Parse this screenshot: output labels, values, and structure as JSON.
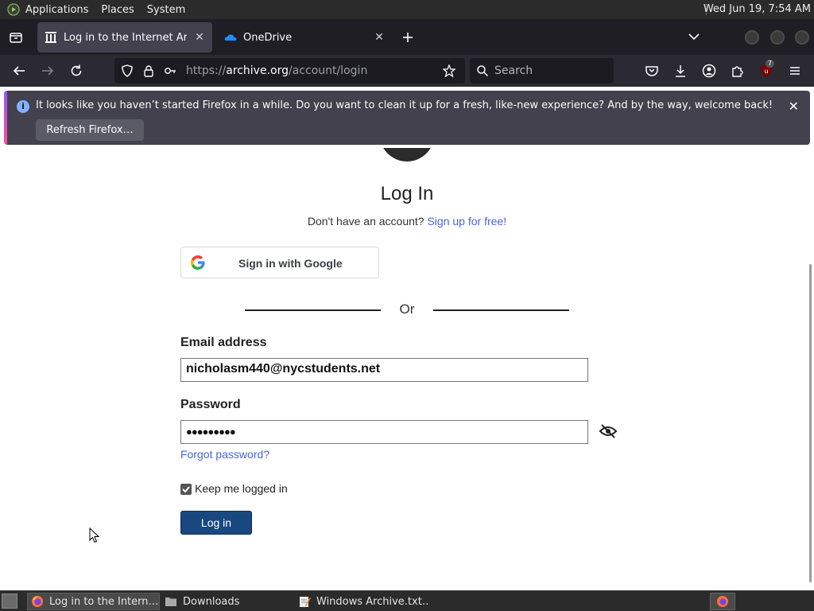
{
  "panel": {
    "menus": [
      "Applications",
      "Places",
      "System"
    ],
    "clock": "Wed Jun 19,  7:54 AM"
  },
  "tabs": [
    {
      "title": "Log in to the Internet Archive",
      "favicon": "archive-icon",
      "active": true
    },
    {
      "title": "OneDrive",
      "favicon": "onedrive-icon",
      "active": false
    }
  ],
  "navbar": {
    "url_prefix": "https://",
    "url_host": "archive.org",
    "url_path": "/account/login",
    "search_placeholder": "Search",
    "extension_badge": "7"
  },
  "notification": {
    "message": "It looks like you haven’t started Firefox in a while. Do you want to clean it up for a fresh, like-new experience? And by the way, welcome back!",
    "button_label": "Refresh Firefox…"
  },
  "login": {
    "title": "Log In",
    "no_account_text": "Don't have an account?",
    "signup_link": "Sign up for free!",
    "google_button": "Sign in with Google",
    "or_text": "Or",
    "email_label": "Email address",
    "email_value": "nicholasm440@nycstudents.net",
    "password_label": "Password",
    "password_value": "●●●●●●●●●",
    "forgot_link": "Forgot password?",
    "keep_logged_in": "Keep me logged in",
    "keep_logged_in_checked": true,
    "login_button": "Log in"
  },
  "taskbar": {
    "items": [
      {
        "label": "Log in to the Intern…",
        "icon": "firefox-icon",
        "active": true
      },
      {
        "label": "Downloads",
        "icon": "folder-icon",
        "active": false
      },
      {
        "label": "Windows Archive.txt…",
        "icon": "text-editor-icon",
        "active": false
      }
    ]
  },
  "colors": {
    "link": "#4b64de",
    "login_button": "#194880",
    "notice_bg": "#42414d",
    "toolbar_bg": "#2b2a33"
  }
}
